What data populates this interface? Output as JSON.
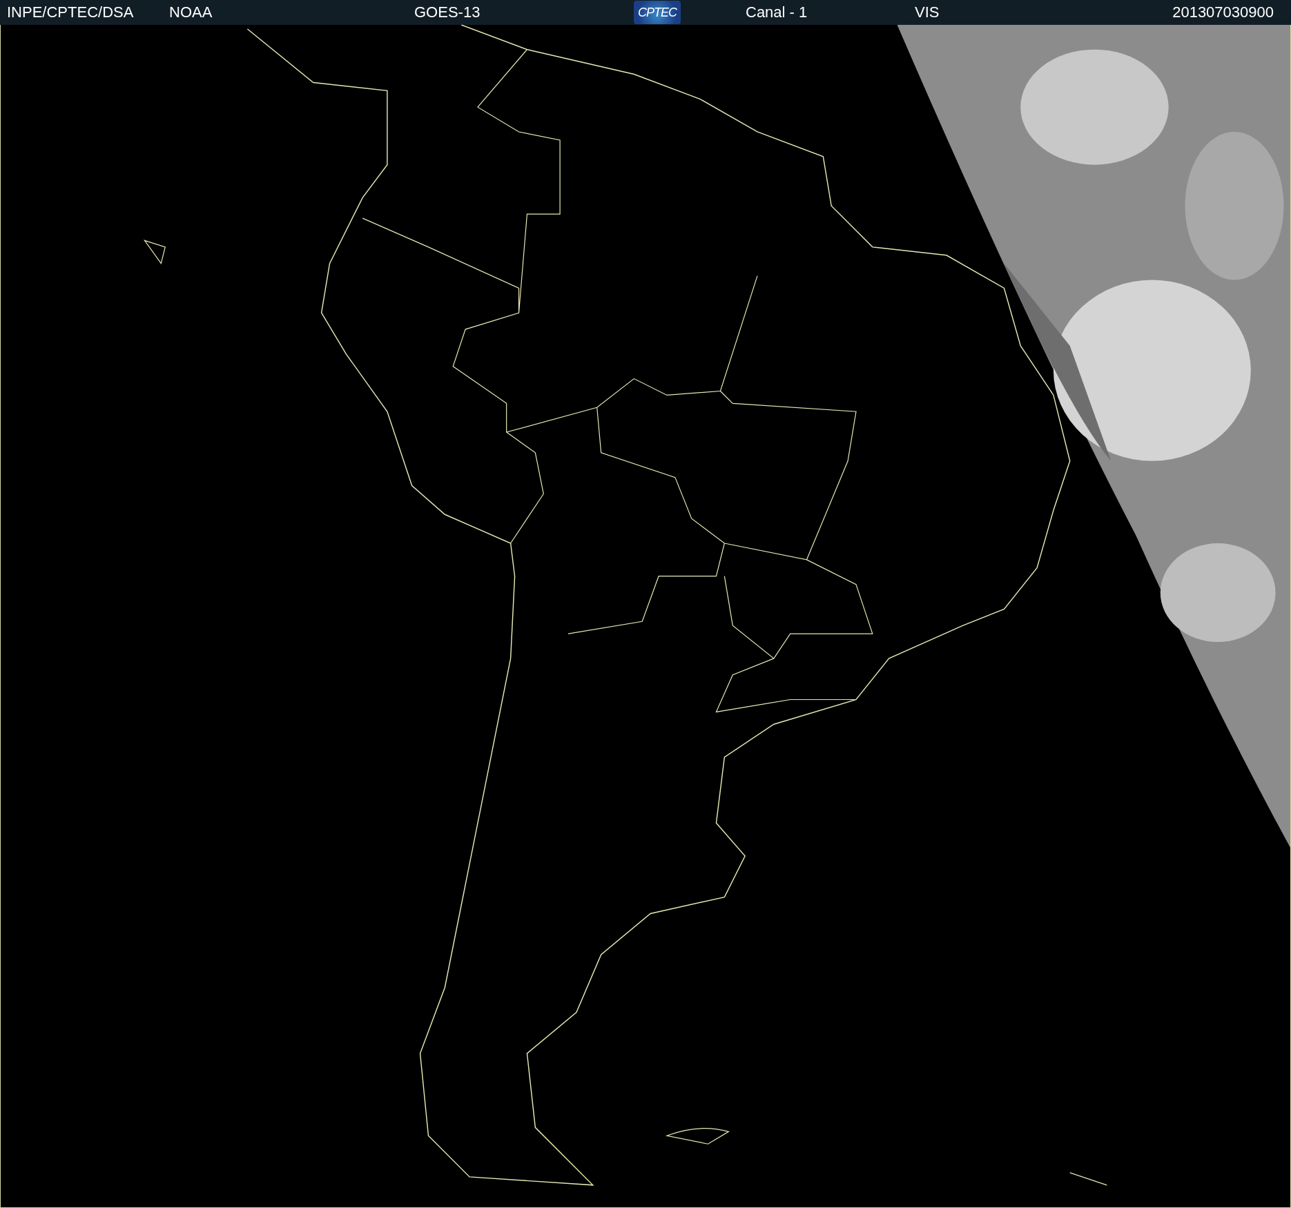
{
  "header": {
    "items": [
      {
        "kind": "text",
        "text": "INPE/CPTEC/DSA"
      },
      {
        "kind": "text",
        "text": "NOAA"
      },
      {
        "kind": "text",
        "text": "GOES-13"
      },
      {
        "kind": "logo",
        "text": "CPTEC"
      },
      {
        "kind": "text",
        "text": "Canal - 1"
      },
      {
        "kind": "text",
        "text": "VIS"
      },
      {
        "kind": "text",
        "text": "201307030900"
      }
    ]
  }
}
